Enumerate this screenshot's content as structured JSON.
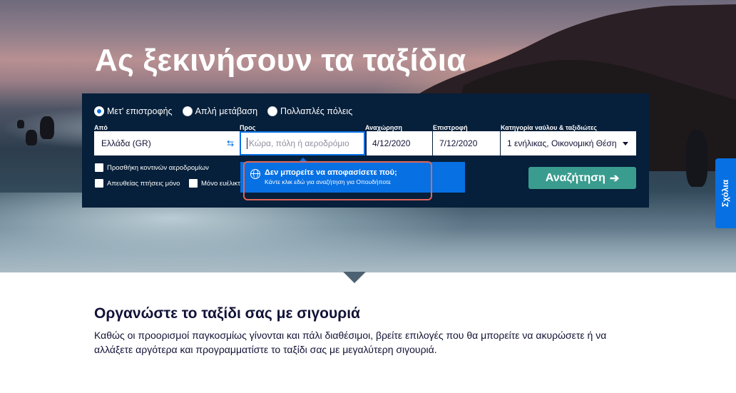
{
  "hero": {
    "title": "Ας ξεκινήσουν τα ταξίδια"
  },
  "search": {
    "trip_types": [
      {
        "label": "Μετ' επιστροφής",
        "selected": true
      },
      {
        "label": "Απλή μετάβαση",
        "selected": false
      },
      {
        "label": "Πολλαπλές πόλεις",
        "selected": false
      }
    ],
    "from": {
      "label": "Από",
      "value": "Ελλάδα (GR)"
    },
    "to": {
      "label": "Προς",
      "placeholder": "Κώρα, πόλη ή αεροδρόμιο"
    },
    "depart": {
      "label": "Αναχώρηση",
      "value": "4/12/2020"
    },
    "return": {
      "label": "Επιστροφή",
      "value": "7/12/2020"
    },
    "cabin": {
      "label": "Κατηγορία ναύλου & ταξιδιώτες",
      "value": "1 ενήλικας, Οικονομική Θέση"
    },
    "checkboxes": [
      {
        "label": "Προσθήκη κοντινών αεροδρομίων",
        "checked": false
      },
      {
        "label": "Απευθείας πτήσεις μόνο",
        "checked": false
      },
      {
        "label": "Μόνο ευέλικτ",
        "checked": false
      }
    ],
    "button_label": "Αναζήτηση",
    "button_arrow": "➔"
  },
  "popup": {
    "title": "Δεν μπορείτε να αποφασίσετε πού;",
    "subtitle": "Κάντε κλικ εδώ για αναζήτηση για Οπουδήποτε",
    "icon": "globe-icon"
  },
  "feedback": {
    "label": "Σχόλια"
  },
  "section": {
    "title": "Οργανώστε το ταξίδι σας με σιγουριά",
    "body": "Καθώς οι προορισμοί παγκοσμίως γίνονται και πάλι διαθέσιμοι, βρείτε επιλογές που θα μπορείτε να ακυρώσετε ή να αλλάξετε αργότερα και προγραμματίστε το ταξίδι σας με μεγαλύτερη σιγουριά."
  },
  "colors": {
    "panel": "#061f3a",
    "accent": "#0770e3",
    "search_button": "#3a9c8e",
    "highlight": "#e0665a",
    "text_dark": "#111236"
  }
}
